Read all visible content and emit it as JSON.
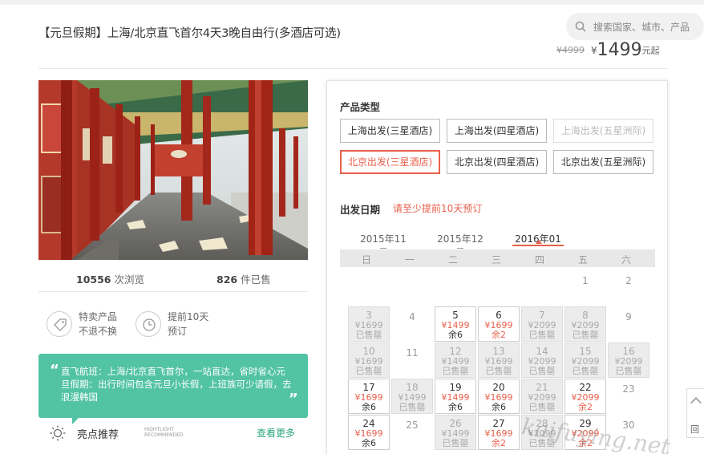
{
  "header": {
    "title": "【元旦假期】上海/北京直飞首尔4天3晚自由行(多酒店可选)",
    "search_placeholder": "搜索国家、城市、产品",
    "old_price": "¥4999",
    "currency": "¥",
    "price": "1499",
    "price_suffix": "元起"
  },
  "stats": {
    "views": "10556",
    "views_label": "次浏览",
    "sold": "826",
    "sold_label": "件已售"
  },
  "badges": [
    {
      "line1": "特卖产品",
      "line2": "不退不换",
      "icon": "tag-icon"
    },
    {
      "line1": "提前10天",
      "line2": "预订",
      "icon": "clock-icon"
    }
  ],
  "highlight": {
    "text": "直飞航班：上海/北京直飞首尔，一站直达，省时省心元旦假期：出行时间包含元旦小长假，上班族可少请假，去浪漫韩国",
    "label": "亮点推荐",
    "label_en_1": "HIGHTLIGHT",
    "label_en_2": "RECOMMENDED",
    "more": "查看更多"
  },
  "booking": {
    "product_type_label": "产品类型",
    "options": [
      {
        "label": "上海出发(三星酒店)",
        "state": "normal"
      },
      {
        "label": "上海出发(四星酒店)",
        "state": "normal"
      },
      {
        "label": "上海出发(五星洲际)",
        "state": "disabled"
      },
      {
        "label": "北京出发(三星酒店)",
        "state": "selected"
      },
      {
        "label": "北京出发(四星酒店)",
        "state": "normal"
      },
      {
        "label": "北京出发(五星洲际)",
        "state": "normal"
      }
    ],
    "date_label": "出发日期",
    "date_hint": "请至少提前10天预订",
    "months": [
      "2015年11",
      "2015年12",
      "2016年01"
    ],
    "active_month": 2,
    "weekdays": [
      "日",
      "一",
      "二",
      "三",
      "四",
      "五",
      "六"
    ],
    "days": [
      {
        "d": "1",
        "col": 5,
        "row": 0,
        "type": "plain"
      },
      {
        "d": "2",
        "col": 6,
        "row": 0,
        "type": "plain"
      },
      {
        "d": "3",
        "col": 0,
        "row": 1,
        "type": "sold",
        "p": "¥1699",
        "s": "已售罄"
      },
      {
        "d": "4",
        "col": 1,
        "row": 1,
        "type": "plain"
      },
      {
        "d": "5",
        "col": 2,
        "row": 1,
        "type": "avail",
        "p": "¥1499",
        "s": "余6"
      },
      {
        "d": "6",
        "col": 3,
        "row": 1,
        "type": "avail",
        "p": "¥1699",
        "s": "余2",
        "warn": true
      },
      {
        "d": "7",
        "col": 4,
        "row": 1,
        "type": "sold",
        "p": "¥2099",
        "s": "已售罄"
      },
      {
        "d": "8",
        "col": 5,
        "row": 1,
        "type": "sold",
        "p": "¥2099",
        "s": "已售罄"
      },
      {
        "d": "9",
        "col": 6,
        "row": 1,
        "type": "plain"
      },
      {
        "d": "10",
        "col": 0,
        "row": 2,
        "type": "sold",
        "p": "¥1699",
        "s": "已售罄"
      },
      {
        "d": "11",
        "col": 1,
        "row": 2,
        "type": "plain"
      },
      {
        "d": "12",
        "col": 2,
        "row": 2,
        "type": "sold",
        "p": "¥1499",
        "s": "已售罄"
      },
      {
        "d": "13",
        "col": 3,
        "row": 2,
        "type": "sold",
        "p": "¥1699",
        "s": "已售罄"
      },
      {
        "d": "14",
        "col": 4,
        "row": 2,
        "type": "sold",
        "p": "¥2099",
        "s": "已售罄"
      },
      {
        "d": "15",
        "col": 5,
        "row": 2,
        "type": "sold",
        "p": "¥2099",
        "s": "已售罄"
      },
      {
        "d": "16",
        "col": 6,
        "row": 2,
        "type": "sold",
        "p": "¥2099",
        "s": "已售罄"
      },
      {
        "d": "17",
        "col": 0,
        "row": 3,
        "type": "avail",
        "p": "¥1699",
        "s": "余6"
      },
      {
        "d": "18",
        "col": 1,
        "row": 3,
        "type": "sold",
        "p": "¥1499",
        "s": "已售罄"
      },
      {
        "d": "19",
        "col": 2,
        "row": 3,
        "type": "avail",
        "p": "¥1499",
        "s": "余6"
      },
      {
        "d": "20",
        "col": 3,
        "row": 3,
        "type": "avail",
        "p": "¥1699",
        "s": "余6"
      },
      {
        "d": "21",
        "col": 4,
        "row": 3,
        "type": "sold",
        "p": "¥2099",
        "s": "已售罄"
      },
      {
        "d": "22",
        "col": 5,
        "row": 3,
        "type": "avail",
        "p": "¥2099",
        "s": "余2",
        "warn": true
      },
      {
        "d": "23",
        "col": 6,
        "row": 3,
        "type": "plain"
      },
      {
        "d": "24",
        "col": 0,
        "row": 4,
        "type": "avail",
        "p": "¥1699",
        "s": "余6"
      },
      {
        "d": "25",
        "col": 1,
        "row": 4,
        "type": "plain"
      },
      {
        "d": "26",
        "col": 2,
        "row": 4,
        "type": "sold",
        "p": "¥1499",
        "s": "已售罄"
      },
      {
        "d": "27",
        "col": 3,
        "row": 4,
        "type": "avail",
        "p": "¥1699",
        "s": "余2",
        "warn": true
      },
      {
        "d": "28",
        "col": 4,
        "row": 4,
        "type": "sold",
        "p": "¥2099",
        "s": "已售罄"
      },
      {
        "d": "29",
        "col": 5,
        "row": 4,
        "type": "avail",
        "p": "¥2099",
        "s": "余2",
        "warn": true
      },
      {
        "d": "30",
        "col": 6,
        "row": 4,
        "type": "plain"
      }
    ]
  },
  "watermark": "kaifuying.net",
  "side_button": "回",
  "colors": {
    "accent": "#e8604c",
    "green": "#52c3a4",
    "link": "#2aa57e"
  }
}
